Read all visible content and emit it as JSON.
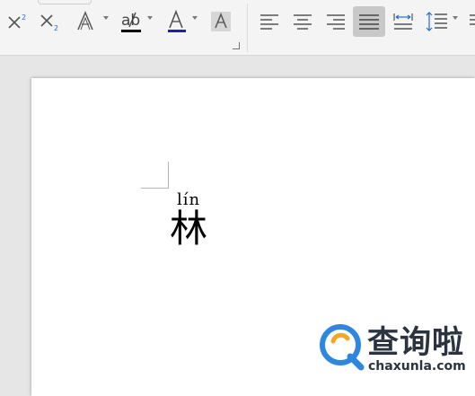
{
  "toolbar": {
    "tools": [
      {
        "name": "superscript",
        "icon": "superscript-icon"
      },
      {
        "name": "subscript",
        "icon": "subscript-icon"
      },
      {
        "name": "text-effects",
        "icon": "text-effect-icon"
      },
      {
        "name": "highlight",
        "icon": "highlight-icon",
        "color": "#000000"
      },
      {
        "name": "font-color",
        "icon": "font-color-icon",
        "color": "#1f1fa8"
      },
      {
        "name": "character-shading",
        "icon": "char-shading-icon"
      },
      {
        "name": "align-left",
        "icon": "align-left-icon"
      },
      {
        "name": "align-center",
        "icon": "align-center-icon"
      },
      {
        "name": "align-right",
        "icon": "align-right-icon"
      },
      {
        "name": "justify",
        "icon": "justify-icon",
        "active": true
      },
      {
        "name": "distributed",
        "icon": "distributed-icon"
      },
      {
        "name": "line-spacing",
        "icon": "line-spacing-icon"
      }
    ],
    "colors": {
      "background": "#f4f4f4",
      "active_button": "#c8c8c8",
      "font_color_bar": "#1f1fa8"
    }
  },
  "document": {
    "pinyin": "lín",
    "hanzi": "林"
  },
  "watermark": {
    "title": "查询啦",
    "domain": "chaxunla.com",
    "logo_colors": {
      "blue": "#2e86de",
      "orange": "#f5a623"
    }
  }
}
